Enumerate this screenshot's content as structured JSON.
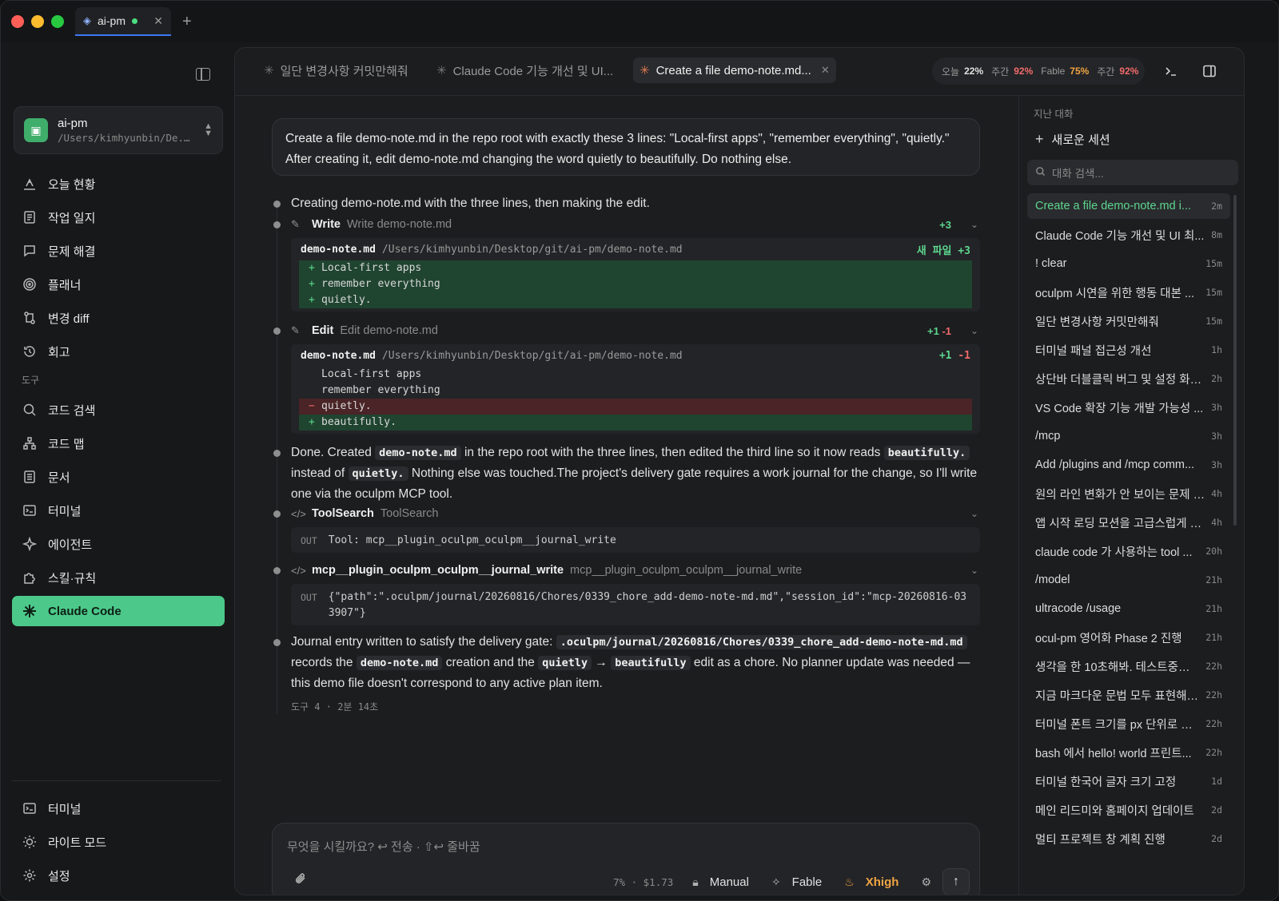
{
  "window_tab": {
    "title": "ai-pm"
  },
  "sidebar": {
    "project": {
      "name": "ai-pm",
      "path": "/Users/kimhyunbin/De..."
    },
    "nav": [
      {
        "label": "오늘 현황",
        "icon": "home-status-icon"
      },
      {
        "label": "작업 일지",
        "icon": "journal-icon"
      },
      {
        "label": "문제 해결",
        "icon": "chat-bubble-icon"
      },
      {
        "label": "플래너",
        "icon": "target-icon"
      },
      {
        "label": "변경 diff",
        "icon": "git-diff-icon"
      },
      {
        "label": "회고",
        "icon": "history-icon"
      }
    ],
    "tools_section": "도구",
    "tools": [
      {
        "label": "코드 검색",
        "icon": "search-icon"
      },
      {
        "label": "코드 맵",
        "icon": "code-map-icon"
      },
      {
        "label": "문서",
        "icon": "document-icon"
      },
      {
        "label": "터미널",
        "icon": "terminal-icon"
      },
      {
        "label": "에이전트",
        "icon": "sparkle-icon"
      },
      {
        "label": "스킬·규칙",
        "icon": "puzzle-icon"
      },
      {
        "label": "Claude Code",
        "icon": "claude-icon",
        "active": true
      }
    ],
    "bottom": [
      {
        "label": "터미널",
        "icon": "terminal-icon"
      },
      {
        "label": "라이트 모드",
        "icon": "sun-icon"
      },
      {
        "label": "설정",
        "icon": "gear-icon"
      }
    ]
  },
  "tabs": [
    {
      "label": "일단 변경사항 커밋만해줘"
    },
    {
      "label": "Claude Code 기능 개선 및 UI..."
    },
    {
      "label": "Create a file demo-note.md...",
      "active": true
    }
  ],
  "usage": {
    "today_label": "오늘",
    "today_value": "22%",
    "week_label": "주간",
    "week_value": "92%",
    "fable_label": "Fable",
    "fable_value": "75%",
    "fable_week_label": "주간",
    "fable_week_value": "92%"
  },
  "chat": {
    "user_message": "Create a file demo-note.md in the repo root with exactly these 3 lines: \"Local-first apps\", \"remember everything\", \"quietly.\" After creating it, edit demo-note.md changing the word quietly to beautifully. Do nothing else.",
    "step1": "Creating demo-note.md with the three lines, then making the edit.",
    "write": {
      "name": "Write",
      "desc": "Write demo-note.md",
      "stat": "+3",
      "file": "demo-note.md",
      "path": "/Users/kimhyunbin/Desktop/git/ai-pm/demo-note.md",
      "badge_label": "새 파일",
      "badge_stat": "+3",
      "lines": [
        "Local-first apps",
        "remember everything",
        "quietly."
      ]
    },
    "edit": {
      "name": "Edit",
      "desc": "Edit demo-note.md",
      "stat_add": "+1",
      "stat_del": "-1",
      "file": "demo-note.md",
      "path": "/Users/kimhyunbin/Desktop/git/ai-pm/demo-note.md",
      "ctx1": "Local-first apps",
      "ctx2": "remember everything",
      "del": "quietly.",
      "add": "beautifully."
    },
    "done": {
      "p1": "Done. Created ",
      "c1": "demo-note.md",
      "p2": " in the repo root with the three lines, then edited the third line so it now reads ",
      "c2": "beautifully.",
      "p3": " instead of ",
      "c3": "quietly.",
      "p4": " Nothing else was touched.The project's delivery gate requires a work journal for the change, so I'll write one via the oculpm MCP tool."
    },
    "toolsearch": {
      "name": "ToolSearch",
      "desc": "ToolSearch",
      "out_label": "OUT",
      "out": "Tool: mcp__plugin_oculpm_oculpm__journal_write"
    },
    "journal": {
      "name": "mcp__plugin_oculpm_oculpm__journal_write",
      "desc": "mcp__plugin_oculpm_oculpm__journal_write",
      "out_label": "OUT",
      "out": "{\"path\":\".oculpm/journal/20260816/Chores/0339_chore_add-demo-note-md.md\",\"session_id\":\"mcp-20260816-033907\"}"
    },
    "final": {
      "p1": "Journal entry written to satisfy the delivery gate: ",
      "c1": ".oculpm/journal/20260816/Chores/0339_chore_add-demo-note-md.md",
      "p2": " records the ",
      "c2": "demo-note.md",
      "p3": " creation and the ",
      "c3": "quietly",
      "arrow": " → ",
      "c4": "beautifully",
      "p4": " edit as a chore. No planner update was needed — this demo file doesn't correspond to any active plan item."
    },
    "meta": "도구 4 · 2분 14초"
  },
  "composer": {
    "placeholder": "무엇을 시킬까요? ↩ 전송 · ⇧↩ 줄바꿈",
    "cost": "7% · $1.73",
    "mode": "Manual",
    "model": "Fable",
    "effort": "Xhigh"
  },
  "history": {
    "title": "지난 대화",
    "new_session": "새로운 세션",
    "search_placeholder": "대화 검색...",
    "items": [
      {
        "title": "Create a file demo-note.md i...",
        "age": "2m",
        "active": true
      },
      {
        "title": "Claude Code 기능 개선 및 UI 최...",
        "age": "8m"
      },
      {
        "title": "! clear",
        "age": "15m"
      },
      {
        "title": "oculpm 시연을 위한 행동 대본 ...",
        "age": "15m"
      },
      {
        "title": "일단 변경사항 커밋만해줘",
        "age": "15m"
      },
      {
        "title": "터미널 패널 접근성 개선",
        "age": "1h"
      },
      {
        "title": "상단바 더블클릭 버그 및 설정 화면 ...",
        "age": "2h"
      },
      {
        "title": "VS Code 확장 기능 개발 가능성 ...",
        "age": "3h"
      },
      {
        "title": "/mcp",
        "age": "3h"
      },
      {
        "title": "Add /plugins and /mcp comm...",
        "age": "3h"
      },
      {
        "title": "원의 라인 변화가 안 보이는 문제 조...",
        "age": "4h"
      },
      {
        "title": "앱 시작 로딩 모션을 고급스럽게 개선",
        "age": "4h"
      },
      {
        "title": "claude code 가 사용하는 tool ...",
        "age": "20h"
      },
      {
        "title": "/model",
        "age": "21h"
      },
      {
        "title": "ultracode /usage",
        "age": "21h"
      },
      {
        "title": "ocul-pm 영어화 Phase 2 진행",
        "age": "21h"
      },
      {
        "title": "생각을 한 10초해봐. 테스트중이야",
        "age": "22h"
      },
      {
        "title": "지금 마크다운 문법 모두 표현해봐...",
        "age": "22h"
      },
      {
        "title": "터미널 폰트 크기를 px 단위로 조절",
        "age": "22h"
      },
      {
        "title": "bash 에서 hello! world 프린트...",
        "age": "22h"
      },
      {
        "title": "터미널 한국어 글자 크기 고정",
        "age": "1d"
      },
      {
        "title": "메인 리드미와 홈페이지 업데이트",
        "age": "2d"
      },
      {
        "title": "멀티 프로젝트 창 계획 진행",
        "age": "2d"
      }
    ]
  }
}
